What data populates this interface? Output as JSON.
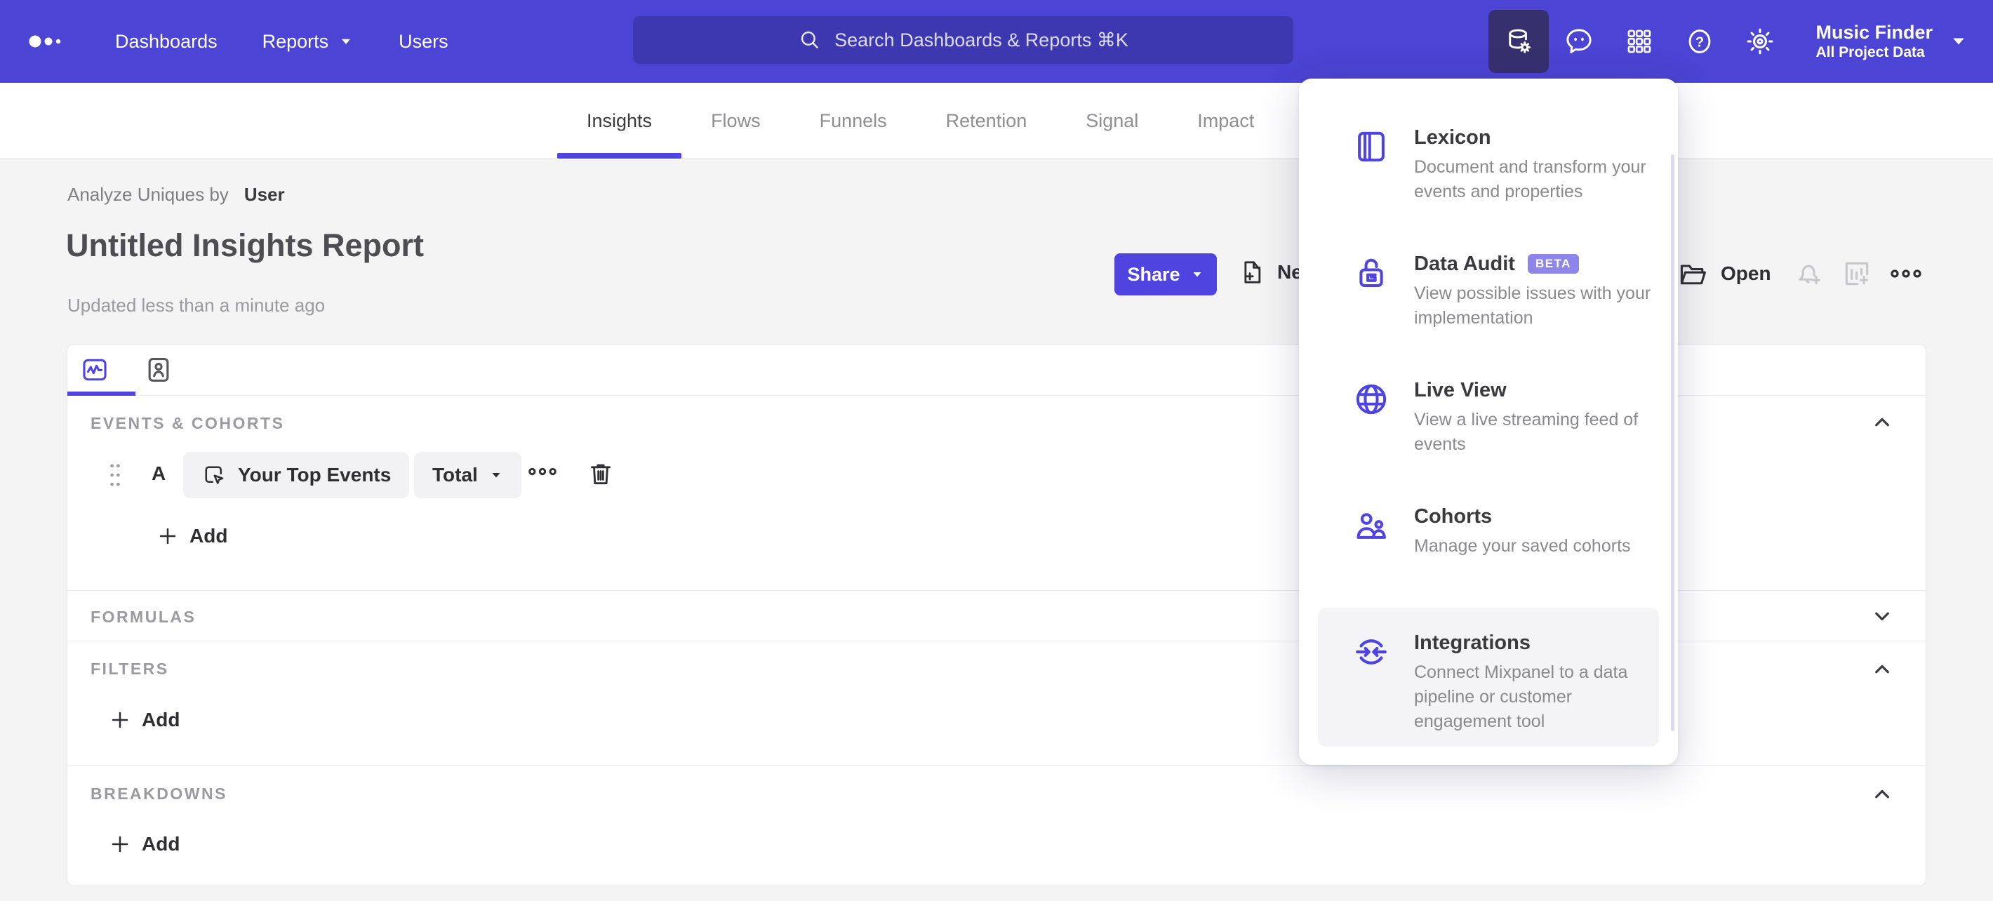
{
  "topnav": {
    "items": [
      "Dashboards",
      "Reports",
      "Users"
    ],
    "search_placeholder": "Search Dashboards & Reports ⌘K",
    "project": {
      "name": "Music Finder",
      "scope": "All Project Data"
    }
  },
  "tabs": {
    "items": [
      "Insights",
      "Flows",
      "Funnels",
      "Retention",
      "Signal",
      "Impact"
    ],
    "active": "Insights"
  },
  "report": {
    "analyze_label": "Analyze Uniques by",
    "analyze_value": "User",
    "title": "Untitled Insights Report",
    "updated": "Updated less than a minute ago",
    "share_label": "Share",
    "new_label": "Ne",
    "open_label": "Open"
  },
  "builder": {
    "sections": {
      "events": "EVENTS & COHORTS",
      "formulas": "FORMULAS",
      "filters": "FILTERS",
      "breakdowns": "BREAKDOWNS"
    },
    "row": {
      "letter": "A",
      "event": "Your Top Events",
      "metric": "Total"
    },
    "add_label": "Add"
  },
  "menu": {
    "items": [
      {
        "title": "Lexicon",
        "description": "Document and transform your events and properties",
        "icon": "lexicon-book-icon",
        "highlighted": false
      },
      {
        "title": "Data Audit",
        "badge": "BETA",
        "description": "View possible issues with your implementation",
        "icon": "data-audit-lock-icon",
        "highlighted": false
      },
      {
        "title": "Live View",
        "description": "View a live streaming feed of events",
        "icon": "live-view-globe-icon",
        "highlighted": false
      },
      {
        "title": "Cohorts",
        "description": "Manage your saved cohorts",
        "icon": "cohorts-people-icon",
        "highlighted": false
      },
      {
        "title": "Integrations",
        "description": "Connect Mixpanel to a data pipeline or customer engagement tool",
        "icon": "integrations-sync-icon",
        "highlighted": true
      }
    ]
  },
  "colors": {
    "accent": "#4F44E0",
    "topbar": "#4B44D4",
    "beta_badge": "#8D85EA"
  }
}
